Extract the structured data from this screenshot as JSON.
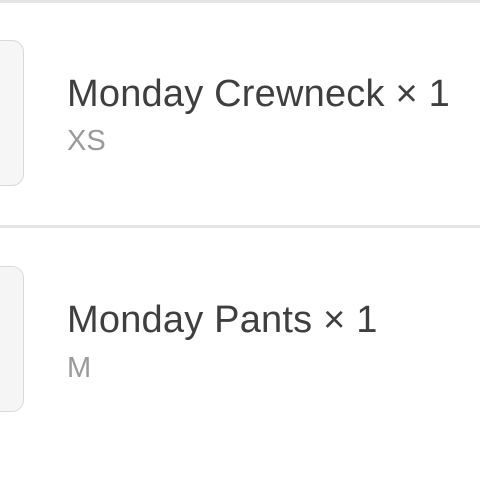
{
  "cart": {
    "items": [
      {
        "name": "Monday Crewneck × 1",
        "size": "XS",
        "thumbnail_icon": "crewneck-sweater-image",
        "thumbnail_color": "#2f6e98"
      },
      {
        "name": "Monday Pants × 1",
        "size": "M",
        "thumbnail_icon": "pants-image"
      }
    ]
  }
}
